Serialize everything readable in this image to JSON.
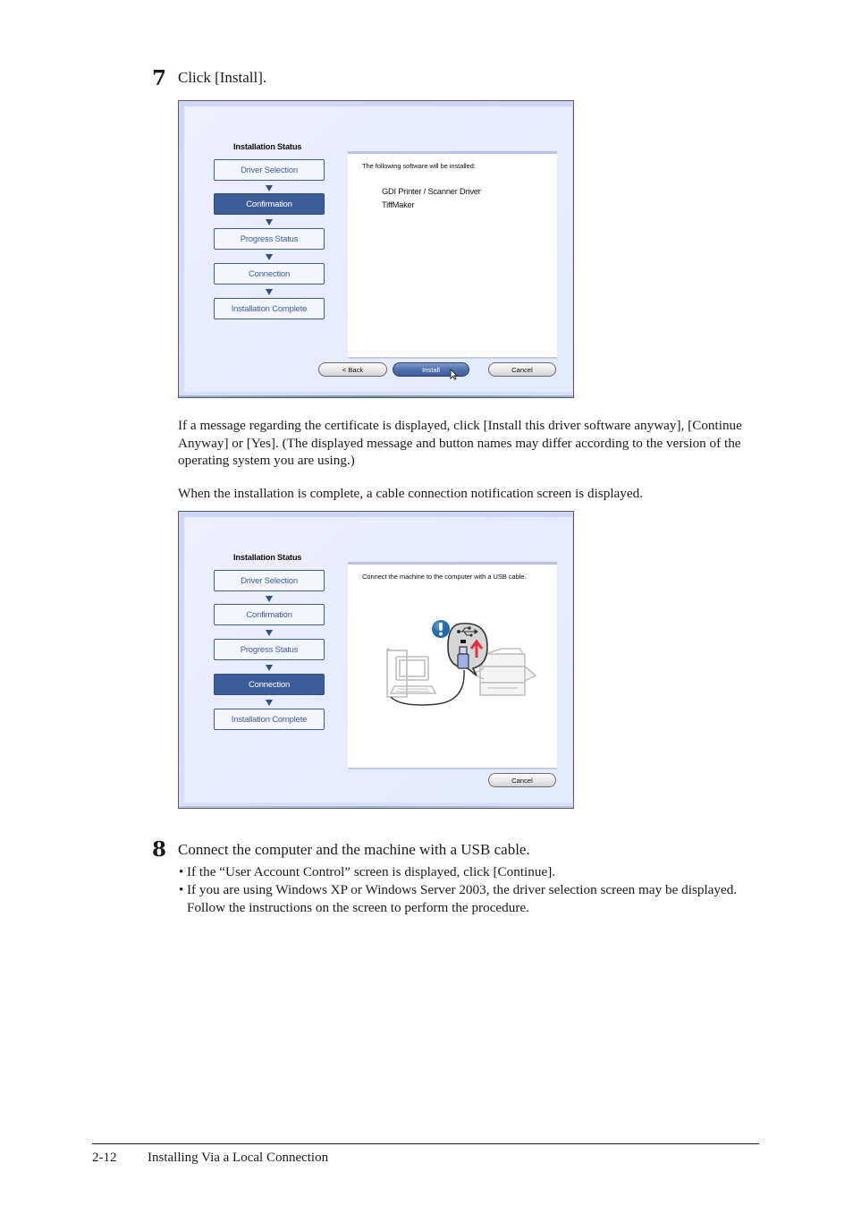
{
  "step7": {
    "number": "7",
    "title": "Click [Install]."
  },
  "screen1": {
    "status_title": "Installation Status",
    "steps": [
      {
        "label": "Driver Selection",
        "active": false
      },
      {
        "label": "Confirmation",
        "active": true
      },
      {
        "label": "Progress Status",
        "active": false
      },
      {
        "label": "Connection",
        "active": false
      },
      {
        "label": "Installation Complete",
        "active": false
      }
    ],
    "message": "The following software will be installed:",
    "software": [
      "GDI Printer / Scanner Driver",
      "TiffMaker"
    ],
    "buttons": {
      "back": "< Back",
      "install": "Install",
      "cancel": "Cancel"
    }
  },
  "para_certificate": "If a message regarding the certificate is displayed, click [Install this driver software anyway], [Continue Anyway] or [Yes]. (The displayed message and button names may differ according to the version of the operating system you are using.)",
  "para_complete": "When the installation is complete, a cable connection notification screen is displayed.",
  "screen2": {
    "status_title": "Installation Status",
    "steps": [
      {
        "label": "Driver Selection",
        "active": false
      },
      {
        "label": "Confirmation",
        "active": false
      },
      {
        "label": "Progress Status",
        "active": false
      },
      {
        "label": "Connection",
        "active": true
      },
      {
        "label": "Installation Complete",
        "active": false
      }
    ],
    "message": "Connect the machine to the computer with a USB cable.",
    "buttons": {
      "cancel": "Cancel"
    },
    "illustration": [
      "computer-icon",
      "usb-plug-icon",
      "up-arrow-icon",
      "exclamation-icon",
      "printer-icon"
    ]
  },
  "step8": {
    "number": "8",
    "title": "Connect the computer and the machine with a USB cable.",
    "bullets": [
      "If the “User Account Control” screen is displayed, click [Continue].",
      "If you are using Windows XP or Windows Server 2003, the driver selection screen may be displayed. Follow the instructions on the screen to perform the procedure."
    ],
    "bullet_char": "•"
  },
  "footer": {
    "page": "2-12",
    "title": "Installing Via a Local Connection"
  },
  "colors": {
    "active_step": "#3b5e98",
    "step_border": "#3d5f99",
    "usb_arrow": "#e53040",
    "alert_badge": "#1f6aa8"
  }
}
